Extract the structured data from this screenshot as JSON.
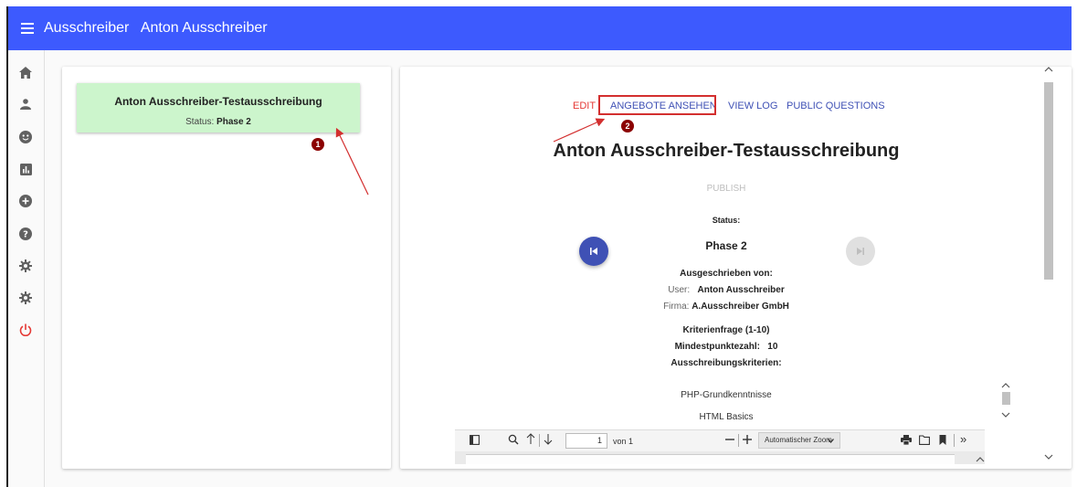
{
  "app": {
    "title": "Ausschreiber   Anton Ausschreiber"
  },
  "sidebar": {
    "items": [
      {
        "name": "home-icon"
      },
      {
        "name": "person-icon"
      },
      {
        "name": "emoji-icon"
      },
      {
        "name": "chart-icon"
      },
      {
        "name": "add-circle-icon"
      },
      {
        "name": "help-icon"
      },
      {
        "name": "settings-icon"
      },
      {
        "name": "settings-icon-2"
      },
      {
        "name": "power-icon"
      }
    ],
    "power_color": "#e53935"
  },
  "list": {
    "tender_title": "Anton Ausschreiber-Testausschreibung",
    "status_label": "Status:",
    "status_value": "Phase 2"
  },
  "annotations": {
    "badge1": "1",
    "badge2": "2",
    "color": "#d32f2f"
  },
  "detail": {
    "links": {
      "edit": "EDIT",
      "angebote": "ANGEBOTE ANSEHEN",
      "view_log": "VIEW LOG",
      "public_questions": "PUBLIC QUESTIONS"
    },
    "title": "Anton Ausschreiber-Testausschreibung",
    "publish": "PUBLISH",
    "status_label": "Status:",
    "status_value": "Phase 2",
    "ausgeschrieben_label": "Ausgeschrieben von:",
    "user_label": "User:",
    "user_value": "Anton Ausschreiber",
    "firma_label": "Firma:",
    "firma_value": "A.Ausschreiber GmbH",
    "kriterienfrage": "Kriterienfrage (1-10)",
    "mindest_label": "Mindestpunktezahl:",
    "mindest_value": "10",
    "kriterien_label": "Ausschreibungskriterien:",
    "criteria": [
      "PHP-Grundkenntnisse",
      "HTML Basics"
    ]
  },
  "pdf_toolbar": {
    "page_value": "1",
    "page_of": "von 1",
    "zoom_option": "Automatischer Zoom",
    "icons": [
      "sidebar-toggle-icon",
      "search-icon",
      "arrow-up-icon",
      "arrow-down-icon",
      "zoom-out-icon",
      "zoom-in-icon",
      "print-icon",
      "open-file-icon",
      "bookmark-icon",
      "more-tools-icon"
    ]
  },
  "colors": {
    "accent": "#3d5afe",
    "link": "#3f51b5",
    "edit": "#e53935",
    "card_green": "#ccf5cc",
    "fab_blue": "#3f51b5"
  }
}
